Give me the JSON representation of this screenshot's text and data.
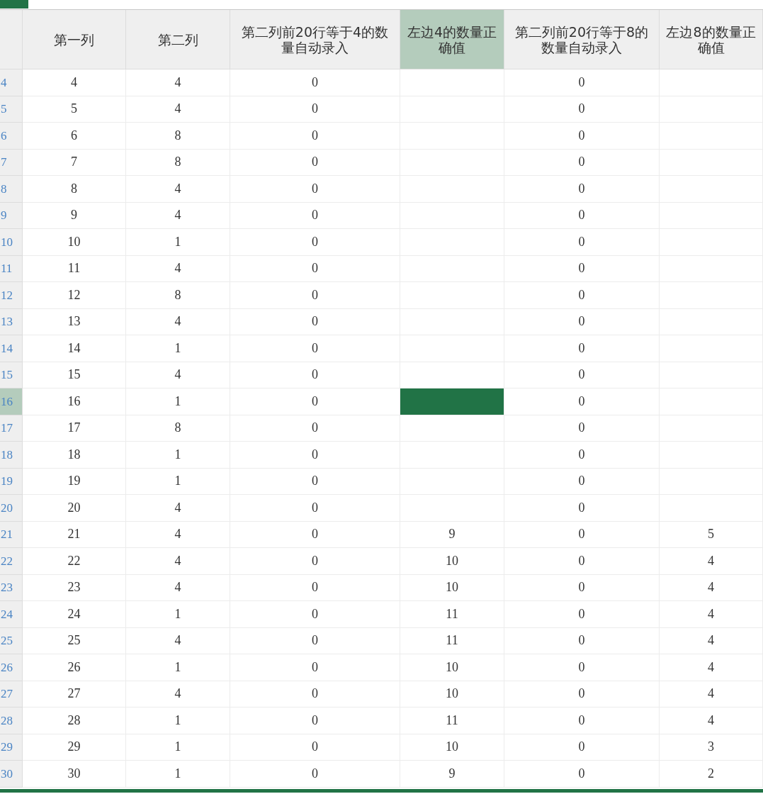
{
  "columns": [
    {
      "label": "第一列",
      "selected": false
    },
    {
      "label": "第二列",
      "selected": false
    },
    {
      "label": "第二列前20行等于4的数量自动录入",
      "selected": false
    },
    {
      "label": "左边4的数量正确值",
      "selected": true
    },
    {
      "label": "第二列前20行等于8的数量自动录入",
      "selected": false
    },
    {
      "label": "左边8的数量正确值",
      "selected": false
    }
  ],
  "rows": [
    {
      "number": "4",
      "selected": false,
      "cells": [
        "4",
        "4",
        "0",
        "",
        "0",
        ""
      ]
    },
    {
      "number": "5",
      "selected": false,
      "cells": [
        "5",
        "4",
        "0",
        "",
        "0",
        ""
      ]
    },
    {
      "number": "6",
      "selected": false,
      "cells": [
        "6",
        "8",
        "0",
        "",
        "0",
        ""
      ]
    },
    {
      "number": "7",
      "selected": false,
      "cells": [
        "7",
        "8",
        "0",
        "",
        "0",
        ""
      ]
    },
    {
      "number": "8",
      "selected": false,
      "cells": [
        "8",
        "4",
        "0",
        "",
        "0",
        ""
      ]
    },
    {
      "number": "9",
      "selected": false,
      "cells": [
        "9",
        "4",
        "0",
        "",
        "0",
        ""
      ]
    },
    {
      "number": "10",
      "selected": false,
      "cells": [
        "10",
        "1",
        "0",
        "",
        "0",
        ""
      ]
    },
    {
      "number": "11",
      "selected": false,
      "cells": [
        "11",
        "4",
        "0",
        "",
        "0",
        ""
      ]
    },
    {
      "number": "12",
      "selected": false,
      "cells": [
        "12",
        "8",
        "0",
        "",
        "0",
        ""
      ]
    },
    {
      "number": "13",
      "selected": false,
      "cells": [
        "13",
        "4",
        "0",
        "",
        "0",
        ""
      ]
    },
    {
      "number": "14",
      "selected": false,
      "cells": [
        "14",
        "1",
        "0",
        "",
        "0",
        ""
      ]
    },
    {
      "number": "15",
      "selected": false,
      "cells": [
        "15",
        "4",
        "0",
        "",
        "0",
        ""
      ]
    },
    {
      "number": "16",
      "selected": true,
      "cells": [
        "16",
        "1",
        "0",
        "",
        "0",
        ""
      ]
    },
    {
      "number": "17",
      "selected": false,
      "cells": [
        "17",
        "8",
        "0",
        "",
        "0",
        ""
      ]
    },
    {
      "number": "18",
      "selected": false,
      "cells": [
        "18",
        "1",
        "0",
        "",
        "0",
        ""
      ]
    },
    {
      "number": "19",
      "selected": false,
      "cells": [
        "19",
        "1",
        "0",
        "",
        "0",
        ""
      ]
    },
    {
      "number": "20",
      "selected": false,
      "cells": [
        "20",
        "4",
        "0",
        "",
        "0",
        ""
      ]
    },
    {
      "number": "21",
      "selected": false,
      "cells": [
        "21",
        "4",
        "0",
        "9",
        "0",
        "5"
      ]
    },
    {
      "number": "22",
      "selected": false,
      "cells": [
        "22",
        "4",
        "0",
        "10",
        "0",
        "4"
      ]
    },
    {
      "number": "23",
      "selected": false,
      "cells": [
        "23",
        "4",
        "0",
        "10",
        "0",
        "4"
      ]
    },
    {
      "number": "24",
      "selected": false,
      "cells": [
        "24",
        "1",
        "0",
        "11",
        "0",
        "4"
      ]
    },
    {
      "number": "25",
      "selected": false,
      "cells": [
        "25",
        "4",
        "0",
        "11",
        "0",
        "4"
      ]
    },
    {
      "number": "26",
      "selected": false,
      "cells": [
        "26",
        "1",
        "0",
        "10",
        "0",
        "4"
      ]
    },
    {
      "number": "27",
      "selected": false,
      "cells": [
        "27",
        "4",
        "0",
        "10",
        "0",
        "4"
      ]
    },
    {
      "number": "28",
      "selected": false,
      "cells": [
        "28",
        "1",
        "0",
        "11",
        "0",
        "4"
      ]
    },
    {
      "number": "29",
      "selected": false,
      "cells": [
        "29",
        "1",
        "0",
        "10",
        "0",
        "3"
      ]
    },
    {
      "number": "30",
      "selected": false,
      "cells": [
        "30",
        "1",
        "0",
        "9",
        "0",
        "2"
      ]
    }
  ]
}
